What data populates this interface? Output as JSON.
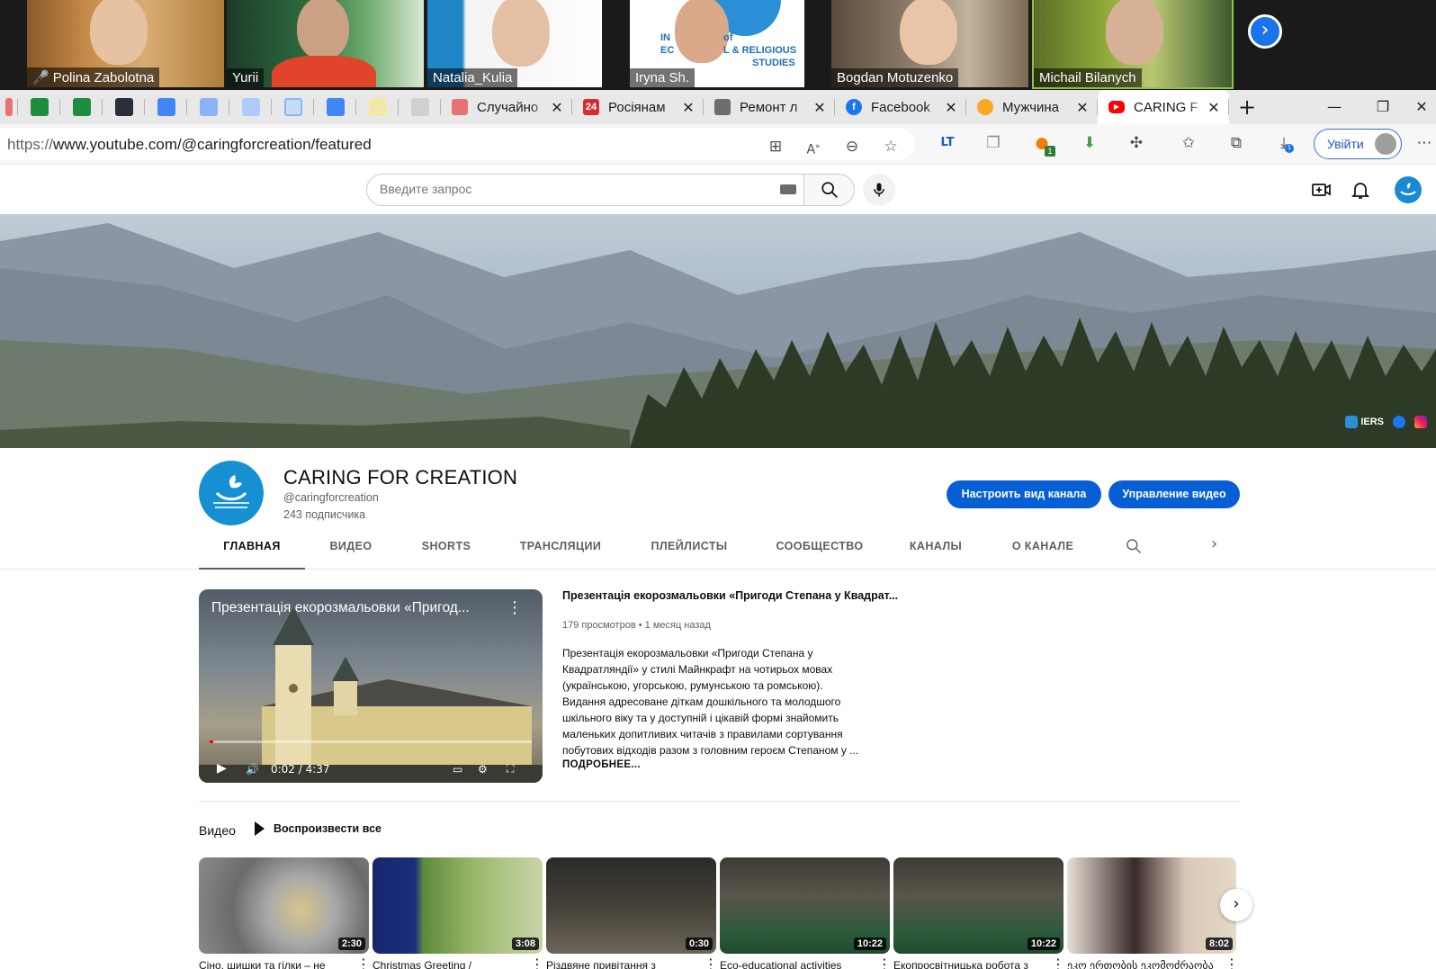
{
  "call": {
    "participants": [
      {
        "name": "Polina Zabolotna",
        "muted": true
      },
      {
        "name": "Yurii"
      },
      {
        "name": "Natalia_Kulia"
      },
      {
        "name": "Iryna Sh."
      },
      {
        "name": "Bogdan Motuzenko"
      },
      {
        "name": "Michail Bilanych"
      }
    ],
    "iryna_bg_text": [
      "IN",
      "of",
      "EC",
      "L & RELIGIOUS",
      "STUDIES"
    ]
  },
  "browser": {
    "tabs": [
      {
        "label": "Случайно",
        "favicon_color": "#e57373"
      },
      {
        "label": "Росіянам",
        "favicon_color": "#d32f2f",
        "favicon_text": "24"
      },
      {
        "label": "Ремонт л",
        "favicon_color": "#6d6d6d"
      },
      {
        "label": "Facebook",
        "favicon_color": "#1877f2"
      },
      {
        "label": "Мужчина",
        "favicon_color": "#f9a825"
      },
      {
        "label": "CARING F",
        "favicon_color": "#ff0000",
        "active": true
      }
    ],
    "close_glyph": "✕",
    "new_tab_glyph": "+",
    "window_controls": [
      "—",
      "❐",
      "✕"
    ],
    "url_prefix": "https://",
    "url_rest": "www.youtube.com/@caringforcreation/featured",
    "signin_label": "Увійти",
    "download_badge": "1",
    "ext_badge": "1"
  },
  "youtube": {
    "search_placeholder": "Введите запрос",
    "banner_links": [
      "IERS"
    ],
    "channel": {
      "title": "CARING FOR CREATION",
      "handle": "@caringforcreation",
      "subscribers": "243 подписчика",
      "btn_customize": "Настроить вид канала",
      "btn_manage": "Управление видео"
    },
    "tabs": [
      "ГЛАВНАЯ",
      "ВИДЕО",
      "SHORTS",
      "ТРАНСЛЯЦИИ",
      "ПЛЕЙЛИСТЫ",
      "СООБЩЕСТВО",
      "КАНАЛЫ",
      "О КАНАЛЕ"
    ],
    "featured": {
      "player_title": "Презентація екорозмальовки «Пригод...",
      "time": "0:02 / 4:37",
      "progress": 0.01,
      "title": "Презентація екорозмальовки «Пригоди Степана у Квадрат...",
      "views": "179 просмотров",
      "ago": "1 месяц назад",
      "desc": [
        "Презентація екорозмальовки «Пригоди Степана у",
        "Квадратляндії» у стилі Майнкрафт на чотирьох мовах",
        "(українською, угорською, румунською та ромською).",
        "Видання адресоване діткам дошкільного та молодшого",
        "шкільного віку та у доступній і цікавій формі знайомить",
        "маленьких допитливих читачів з правилами сортування",
        "побутових відходів разом з головним героєм Степаном у ..."
      ],
      "more": "ПОДРОБНЕЕ..."
    },
    "shelf": {
      "title": "Видео",
      "play_all": "Воспроизвести все",
      "videos": [
        {
          "title": "Сіно, шишки та гілки – не",
          "duration": "2:30"
        },
        {
          "title": "Christmas Greeting /",
          "duration": "3:08"
        },
        {
          "title": "Різдвяне привітання з",
          "duration": "0:30"
        },
        {
          "title": "Eco-educational activities",
          "duration": "10:22"
        },
        {
          "title": "Екопросвітницька робота з",
          "duration": "10:22"
        },
        {
          "title": "ეკო ერთობის ეკომოძრაობა",
          "duration": "8:02"
        }
      ]
    }
  },
  "colors": {
    "yt_blue": "#065fd4",
    "yt_red": "#ff0000",
    "edge_signin": "#1a56c4"
  }
}
